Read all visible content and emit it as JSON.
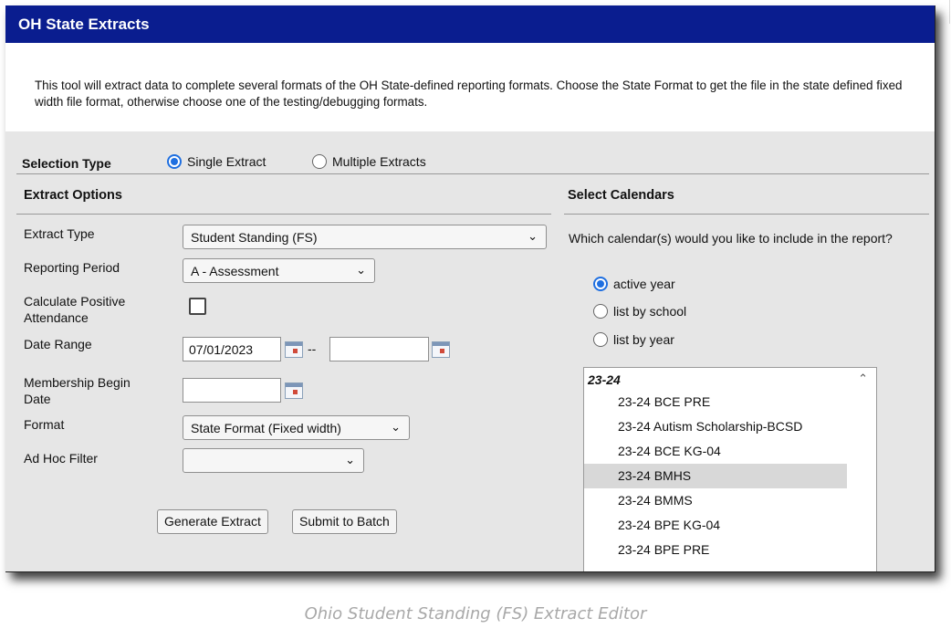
{
  "window": {
    "title": "OH State Extracts",
    "description": "This tool will extract data to complete several formats of the OH State-defined reporting formats. Choose the State Format to get the file in the state defined fixed width file format, otherwise choose one of the testing/debugging formats."
  },
  "selection_type": {
    "label": "Selection Type",
    "options": [
      {
        "label": "Single Extract",
        "selected": true
      },
      {
        "label": "Multiple Extracts",
        "selected": false
      }
    ]
  },
  "extract_options": {
    "heading": "Extract Options",
    "extract_type": {
      "label": "Extract Type",
      "value": "Student Standing (FS)"
    },
    "reporting_period": {
      "label": "Reporting Period",
      "value": "A - Assessment"
    },
    "positive_attendance": {
      "label_line1": "Calculate Positive",
      "label_line2": "Attendance",
      "checked": false
    },
    "date_range": {
      "label": "Date Range",
      "start": "07/01/2023",
      "separator": "--",
      "end": ""
    },
    "membership_begin": {
      "label_line1": "Membership Begin",
      "label_line2": "Date",
      "value": ""
    },
    "format": {
      "label": "Format",
      "value": "State Format (Fixed width)"
    },
    "ad_hoc_filter": {
      "label": "Ad Hoc Filter",
      "value": ""
    },
    "buttons": {
      "generate": "Generate Extract",
      "batch": "Submit to Batch"
    }
  },
  "select_calendars": {
    "heading": "Select Calendars",
    "question": "Which calendar(s) would you like to include in the report?",
    "options": [
      {
        "label": "active year",
        "selected": true
      },
      {
        "label": "list by school",
        "selected": false
      },
      {
        "label": "list by year",
        "selected": false
      }
    ],
    "list": {
      "group": "23-24",
      "items": [
        {
          "label": "23-24 BCE PRE",
          "selected": false
        },
        {
          "label": "23-24 Autism Scholarship-BCSD",
          "selected": false
        },
        {
          "label": "23-24 BCE KG-04",
          "selected": false
        },
        {
          "label": "23-24 BMHS",
          "selected": true
        },
        {
          "label": "23-24 BMMS",
          "selected": false
        },
        {
          "label": "23-24 BPE KG-04",
          "selected": false
        },
        {
          "label": "23-24 BPE PRE",
          "selected": false
        }
      ]
    }
  },
  "caption": "Ohio Student Standing (FS) Extract Editor",
  "icons": {
    "dropdown": "chevron-down-icon",
    "calendar": "calendar-icon",
    "scroll_up": "chevron-up-icon"
  },
  "colors": {
    "title_bar": "#0a1d8f",
    "radio_selected": "#1f6fe0",
    "list_selected": "#d8d8d8"
  }
}
